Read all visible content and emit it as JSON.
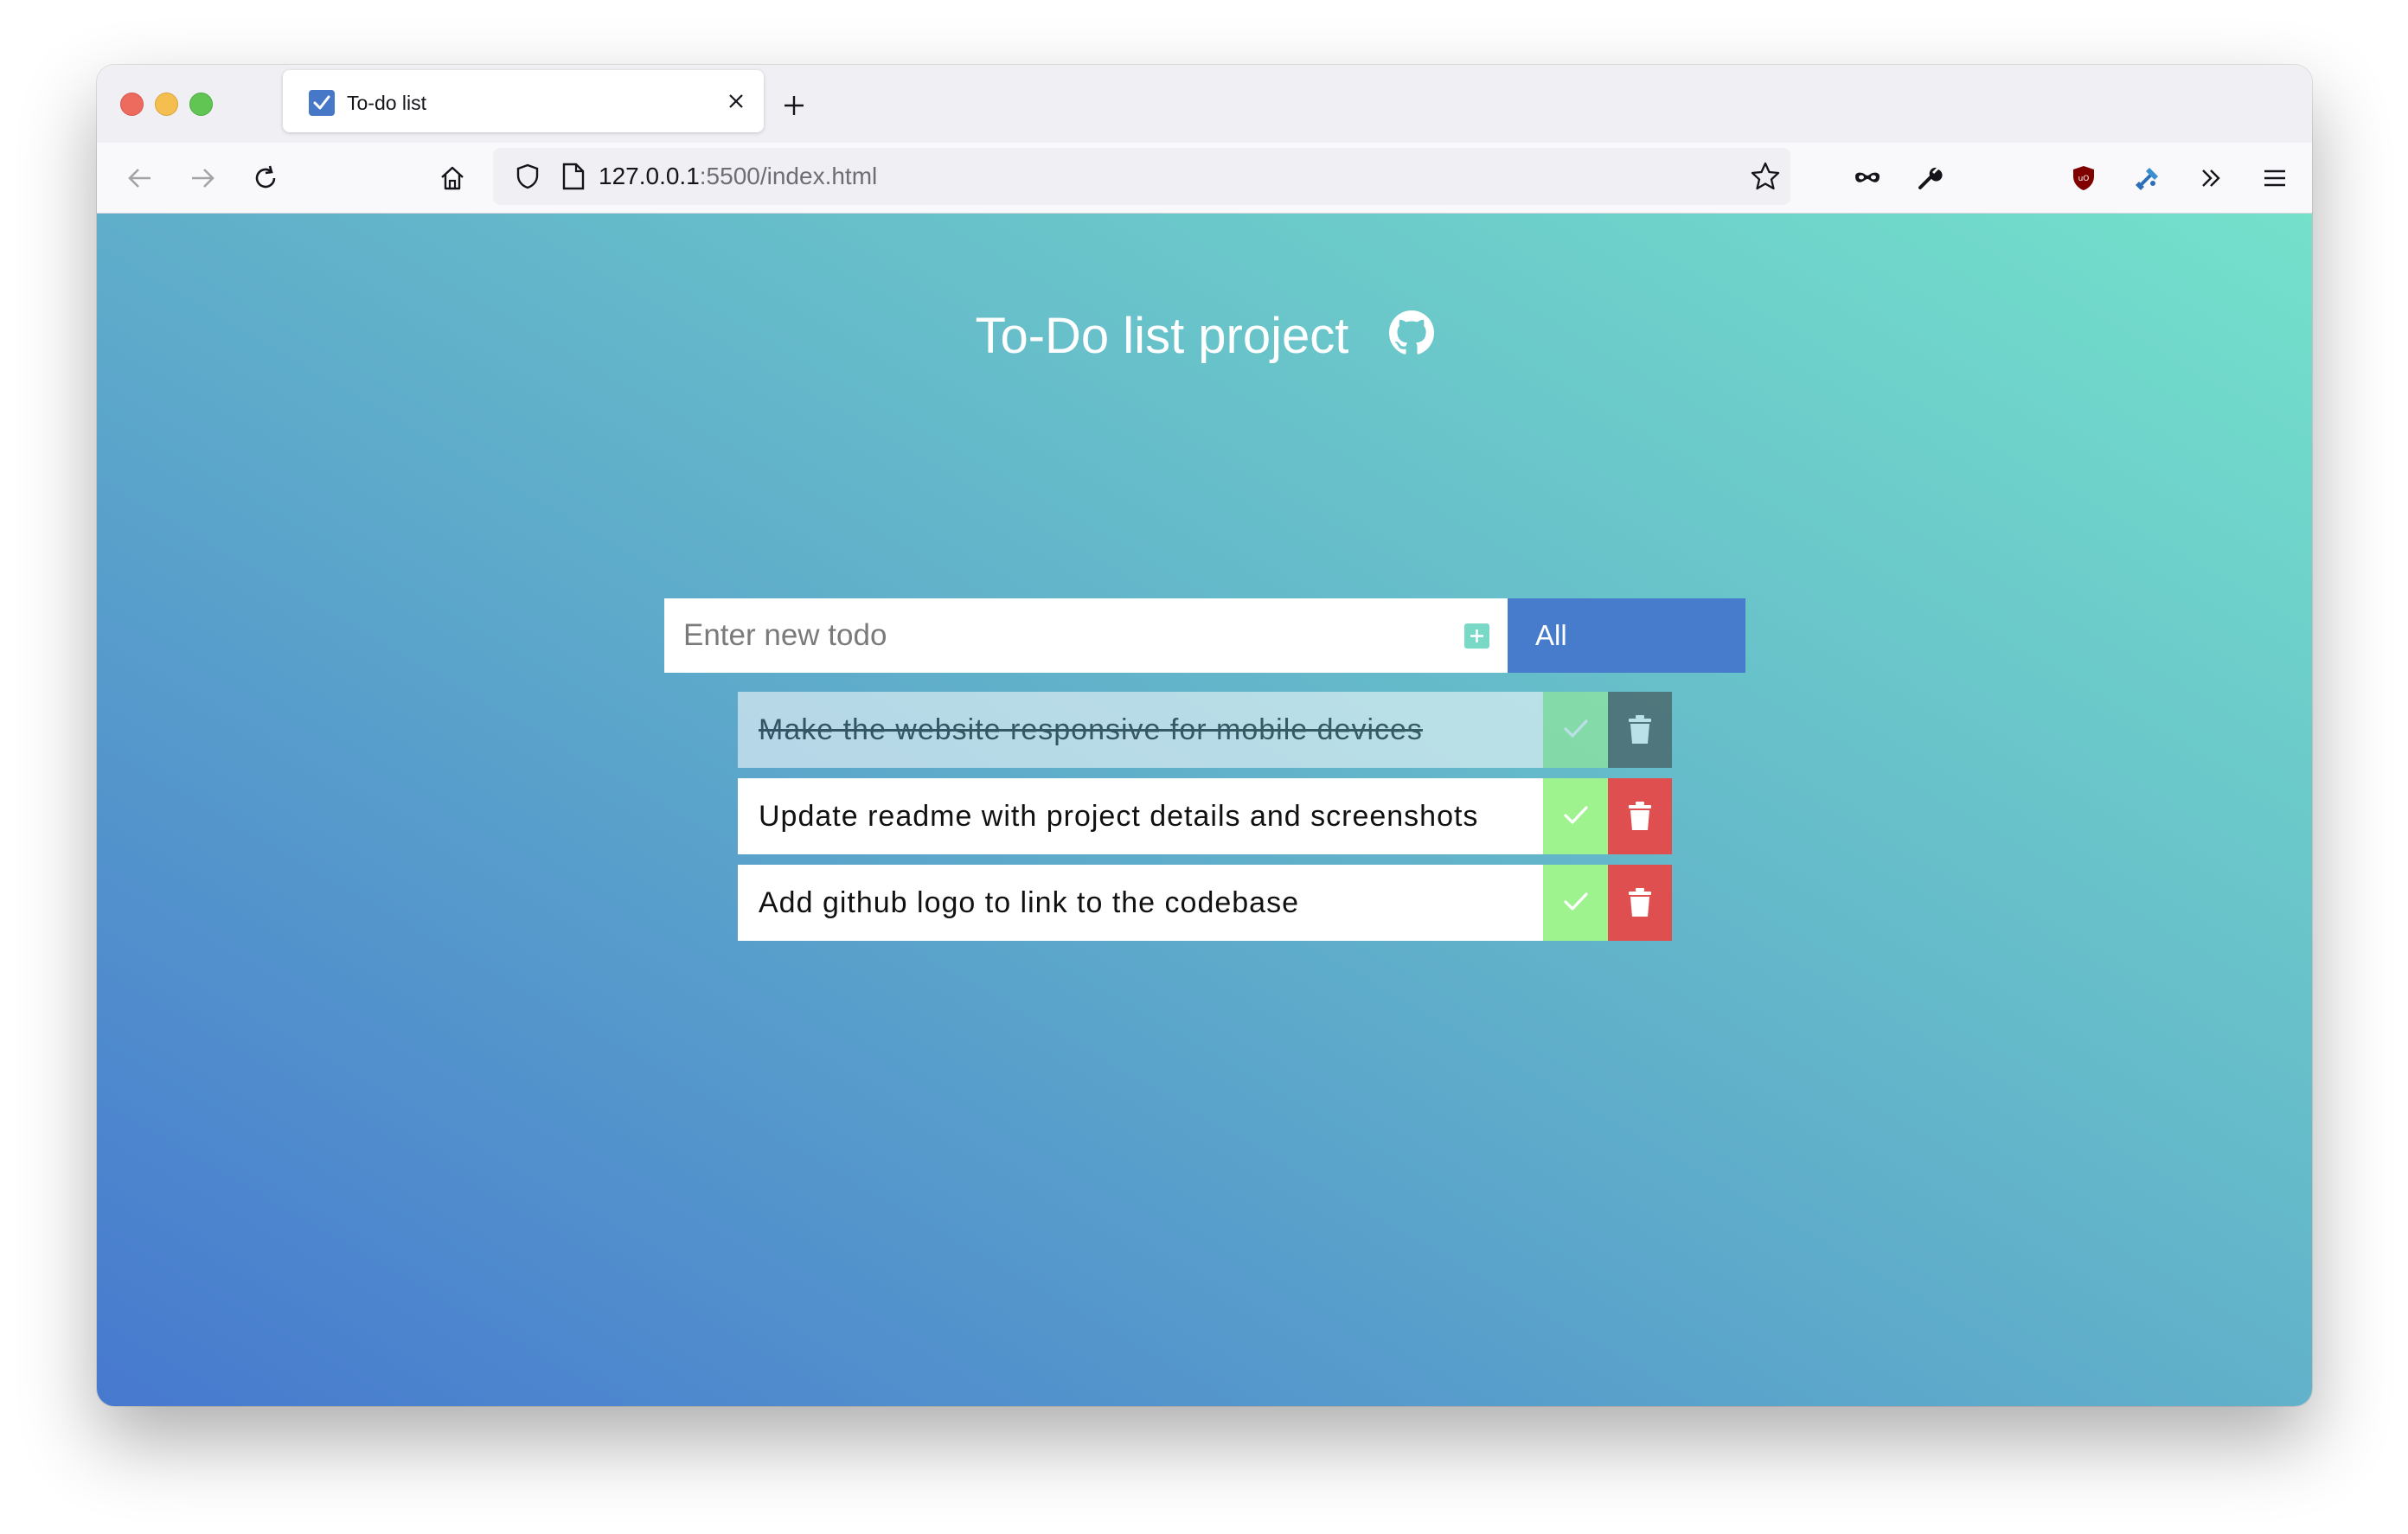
{
  "browser": {
    "tab": {
      "title": "To-do list"
    },
    "url": {
      "host": "127.0.0.1",
      "rest": ":5500/index.html"
    }
  },
  "page": {
    "title": "To-Do list project",
    "input": {
      "placeholder": "Enter new todo"
    },
    "filter": {
      "selected": "All"
    },
    "todos": [
      {
        "text": "Make the website responsive for mobile devices",
        "completed": true
      },
      {
        "text": "Update readme with project details and screenshots",
        "completed": false
      },
      {
        "text": "Add github logo to link to the codebase",
        "completed": false
      }
    ]
  },
  "colors": {
    "accent": "#477bcc",
    "check": "#9ff38f",
    "delete": "#e04f50",
    "gradient_start": "#4779cf",
    "gradient_end": "#74e1cb"
  },
  "icons": {
    "tab": "checkbox-icon",
    "github": "github-icon",
    "add": "plus-square-icon",
    "check": "checkmark-icon",
    "delete": "trash-icon"
  }
}
